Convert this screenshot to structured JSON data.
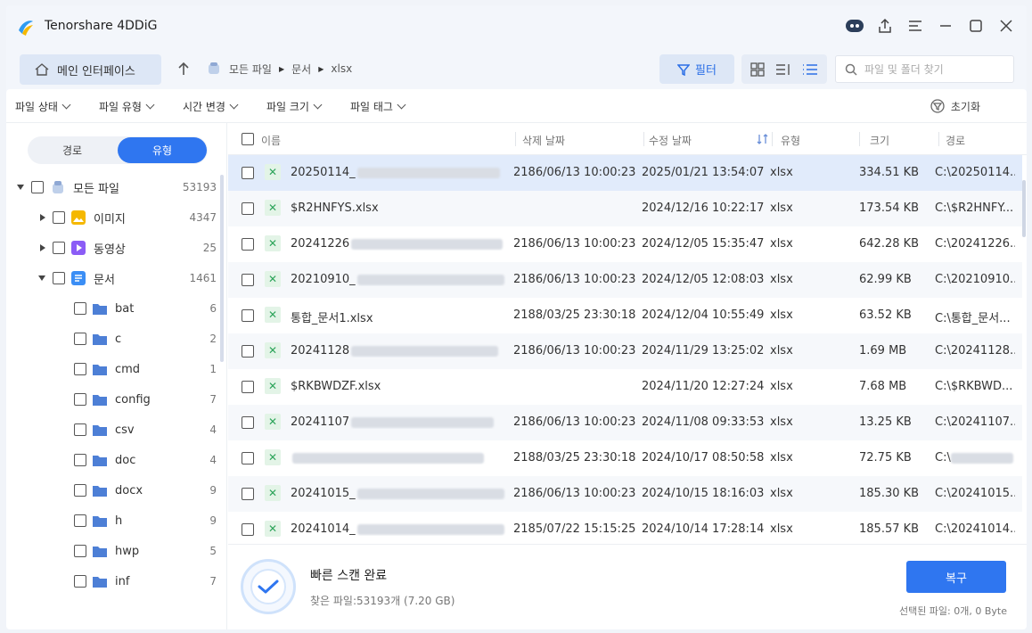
{
  "app": {
    "title": "Tenorshare 4DDiG"
  },
  "nav": {
    "home_label": "메인 인터페이스",
    "breadcrumbs": [
      "모든 파일",
      "문서",
      "xlsx"
    ],
    "filter_label": "필터",
    "search_placeholder": "파일 및 폴더 찾기"
  },
  "filters": {
    "status": "파일 상태",
    "type": "파일 유형",
    "time": "시간 변경",
    "size": "파일 크기",
    "tag": "파일 태그",
    "reset": "초기화"
  },
  "sidebar": {
    "tab_path": "경로",
    "tab_type": "유형",
    "tree": [
      {
        "label": "모든 파일",
        "count": "53193"
      },
      {
        "label": "이미지",
        "count": "4347"
      },
      {
        "label": "동영상",
        "count": "25"
      },
      {
        "label": "문서",
        "count": "1461"
      },
      {
        "label": "bat",
        "count": "6"
      },
      {
        "label": "c",
        "count": "2"
      },
      {
        "label": "cmd",
        "count": "1"
      },
      {
        "label": "config",
        "count": "7"
      },
      {
        "label": "csv",
        "count": "4"
      },
      {
        "label": "doc",
        "count": "4"
      },
      {
        "label": "docx",
        "count": "9"
      },
      {
        "label": "h",
        "count": "9"
      },
      {
        "label": "hwp",
        "count": "5"
      },
      {
        "label": "inf",
        "count": "7"
      }
    ]
  },
  "table": {
    "headers": {
      "name": "이름",
      "deleted": "삭제 날짜",
      "modified": "수정 날짜",
      "type": "유형",
      "size": "크기",
      "path": "경로"
    },
    "rows": [
      {
        "name": "20250114_",
        "deleted": "2186/06/13 10:00:23",
        "modified": "2025/01/21 13:54:07",
        "type": "xlsx",
        "size": "334.51 KB",
        "path": "C:\\20250114..."
      },
      {
        "name": "$R2HNFYS.xlsx",
        "deleted": "",
        "modified": "2024/12/16 10:22:17",
        "type": "xlsx",
        "size": "173.54 KB",
        "path": "C:\\$R2HNFY..."
      },
      {
        "name": "20241226",
        "deleted": "2186/06/13 10:00:23",
        "modified": "2024/12/05 15:35:47",
        "type": "xlsx",
        "size": "642.28 KB",
        "path": "C:\\20241226..."
      },
      {
        "name": "20210910_",
        "deleted": "2186/06/13 10:00:23",
        "modified": "2024/12/05 12:08:03",
        "type": "xlsx",
        "size": "62.99 KB",
        "path": "C:\\20210910..."
      },
      {
        "name": "통합_문서1.xlsx",
        "deleted": "2188/03/25 23:30:18",
        "modified": "2024/12/04 10:55:49",
        "type": "xlsx",
        "size": "63.52 KB",
        "path": "C:\\통합_문서..."
      },
      {
        "name": "20241128",
        "deleted": "2186/06/13 10:00:23",
        "modified": "2024/11/29 13:25:02",
        "type": "xlsx",
        "size": "1.69 MB",
        "path": "C:\\20241128..."
      },
      {
        "name": "$RKBWDZF.xlsx",
        "deleted": "",
        "modified": "2024/11/20 12:27:24",
        "type": "xlsx",
        "size": "7.68 MB",
        "path": "C:\\$RKBWD..."
      },
      {
        "name": "20241107",
        "deleted": "2186/06/13 10:00:23",
        "modified": "2024/11/08 09:33:53",
        "type": "xlsx",
        "size": "13.25 KB",
        "path": "C:\\20241107..."
      },
      {
        "name": "",
        "deleted": "2188/03/25 23:30:18",
        "modified": "2024/10/17 08:50:58",
        "type": "xlsx",
        "size": "72.75 KB",
        "path": "C:\\"
      },
      {
        "name": "20241015_",
        "deleted": "2186/06/13 10:00:23",
        "modified": "2024/10/15 18:16:03",
        "type": "xlsx",
        "size": "185.30 KB",
        "path": "C:\\20241015..."
      },
      {
        "name": "20241014_",
        "deleted": "2185/07/22 15:15:25",
        "modified": "2024/10/14 17:28:14",
        "type": "xlsx",
        "size": "185.57 KB",
        "path": "C:\\20241014..."
      }
    ]
  },
  "status": {
    "title": "빠른 스캔 완료",
    "found": "찾은 파일:53193개 (7.20 GB)",
    "recover_label": "복구",
    "selected": "선택된 파일: 0개, 0 Byte"
  },
  "colors": {
    "accent": "#2f76f0",
    "selected_row": "#e1ebfb",
    "excel_green": "#2da45a"
  }
}
